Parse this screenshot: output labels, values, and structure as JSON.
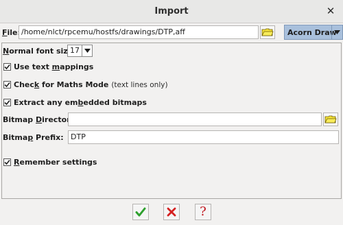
{
  "window": {
    "title": "Import"
  },
  "file": {
    "label_prefix": "",
    "label_u": "F",
    "label_rest": "ile:",
    "value": "/home/nlct/rpcemu/hostfs/drawings/DTP,aff",
    "format": "Acorn Draw"
  },
  "font_size": {
    "label_u": "N",
    "label_rest": "ormal font size:",
    "value": "17"
  },
  "options": {
    "text_mappings": {
      "pre": "Use text ",
      "u": "m",
      "post": "appings",
      "checked": true
    },
    "maths_mode": {
      "pre": "Chec",
      "u": "k",
      "post": " for Maths Mode",
      "note": "(text lines only)",
      "checked": true
    },
    "bitmaps": {
      "pre": "Extract any em",
      "u": "b",
      "post": "edded bitmaps",
      "checked": true
    }
  },
  "bitmap_directory": {
    "pre": "Bitmap ",
    "u": "D",
    "post": "irectory:",
    "value": ""
  },
  "bitmap_prefix": {
    "pre": "Bitma",
    "u": "p",
    "post": " Prefix:",
    "value": "DTP"
  },
  "remember": {
    "pre": "",
    "u": "R",
    "post": "emember settings",
    "checked": true
  },
  "icons": {
    "close": "close-icon",
    "folder": "folder-icon",
    "ok": "ok-check-icon",
    "cancel": "cancel-x-icon",
    "help": "help-question-icon"
  },
  "colors": {
    "ok_green": "#2ea02e",
    "cancel_red": "#d42020",
    "help_red": "#c0141c",
    "folder_yellow": "#f4e23a",
    "combo_blue": "#a9c0dc"
  }
}
